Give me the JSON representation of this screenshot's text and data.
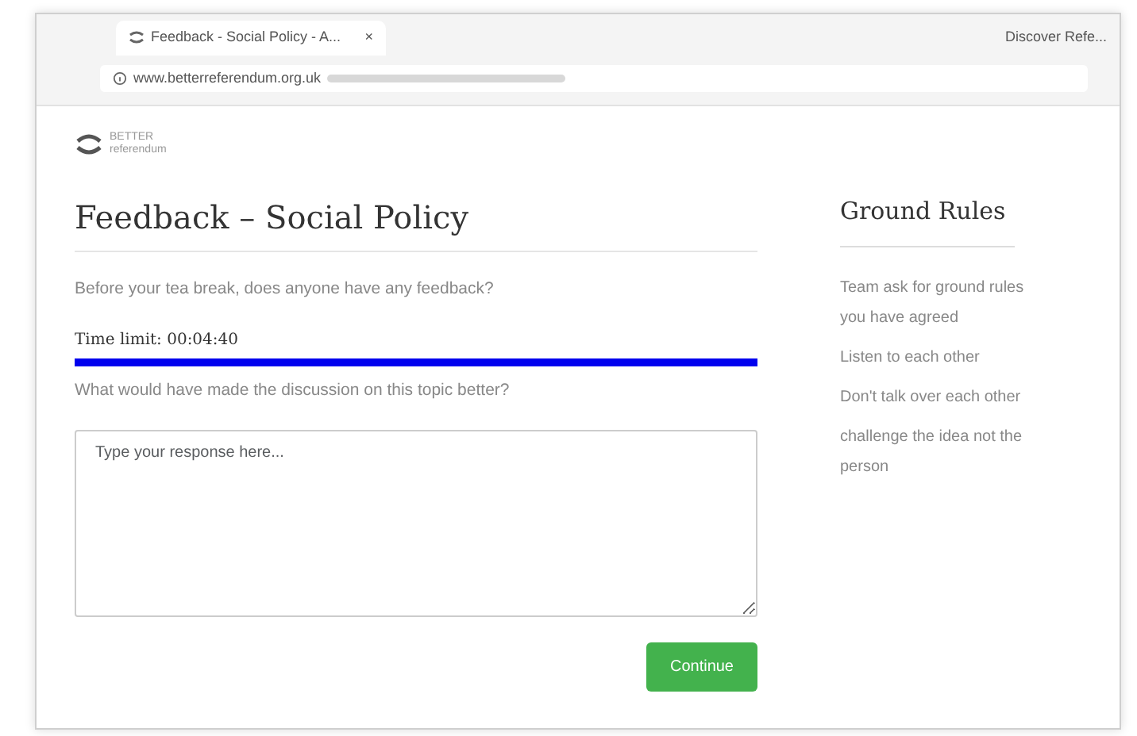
{
  "browser": {
    "tab_title": "Feedback - Social Policy - A...",
    "tab_close": "×",
    "url": "www.betterreferendum.org.uk",
    "profile": "Discover Refe..."
  },
  "logo": {
    "line_1": "BETTER",
    "line_2": "referendum"
  },
  "page": {
    "title": "Feedback – Social Policy",
    "intro": "Before your tea break, does anyone have any feedback?",
    "time_limit": "Time limit: 00:04:40",
    "timer": {
      "level": 1
    },
    "question": "What would have made the discussion on this topic better?",
    "answer": {
      "placeholder": "Type your response here..."
    },
    "button": "Continue"
  },
  "sidebar": {
    "title": "Ground Rules",
    "rules": [
      "Team ask for ground rules you have agreed",
      "Listen to each other",
      "Don't talk over each other",
      "challenge the idea not the person"
    ]
  }
}
